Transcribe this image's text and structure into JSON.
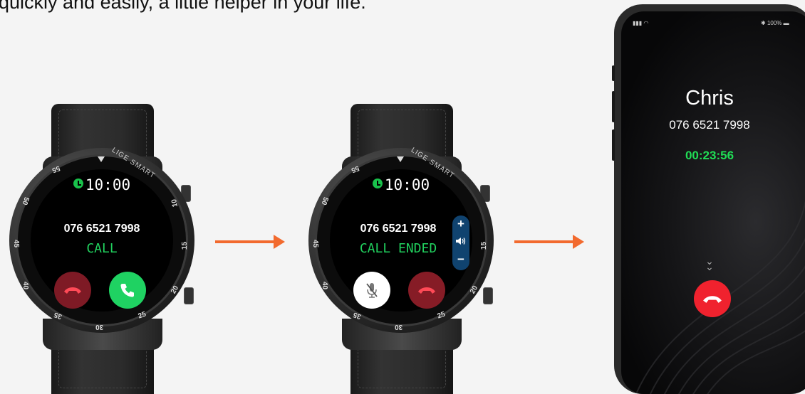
{
  "caption": "quickly and easily, a little helper in your life.",
  "watch_brand": "LIGE SMART",
  "bezel_numbers": [
    "55",
    "5",
    "10",
    "15",
    "20",
    "25",
    "30",
    "35",
    "40",
    "45",
    "50"
  ],
  "watch_incoming": {
    "time": "10:00",
    "number": "076 6521 7998",
    "status": "CALL",
    "buttons": {
      "decline": "decline-button",
      "accept": "accept-button"
    }
  },
  "watch_ended": {
    "time": "10:00",
    "number": "076 6521 7998",
    "status": "CALL ENDED",
    "volume": {
      "plus": "+",
      "minus": "−"
    }
  },
  "phone": {
    "status_bar_right": "100%",
    "name": "Chris",
    "number": "076 6521 7998",
    "timer": "00:23:56"
  },
  "colors": {
    "accept": "#1fd262",
    "decline": "#f0222e",
    "arrow": "#f26a2e",
    "status_text": "#21d15e"
  }
}
